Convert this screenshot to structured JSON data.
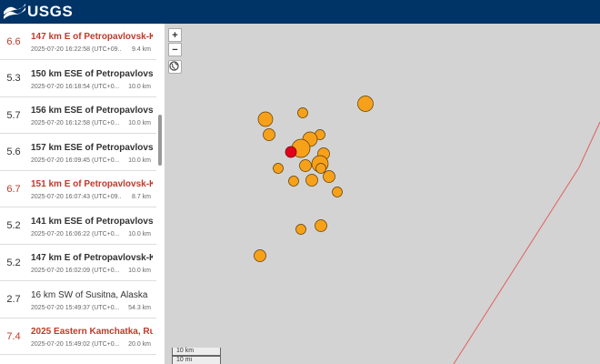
{
  "header": {
    "logo_text": "USGS"
  },
  "events": [
    {
      "mag": "6.6",
      "place": "147 km E of Petropavlovsk-K...",
      "time": "2025-07-20 16:22:58 (UTC+09...",
      "depth": "9.4 km",
      "significant": true,
      "lite": false
    },
    {
      "mag": "5.3",
      "place": "150 km ESE of Petropavlovsk...",
      "time": "2025-07-20 16:18:54 (UTC+0...",
      "depth": "10.0 km",
      "significant": false,
      "lite": false
    },
    {
      "mag": "5.7",
      "place": "156 km ESE of Petropavlovsk...",
      "time": "2025-07-20 16:12:58 (UTC+0...",
      "depth": "10.0 km",
      "significant": false,
      "lite": false
    },
    {
      "mag": "5.6",
      "place": "157 km ESE of Petropavlovsk...",
      "time": "2025-07-20 16:09:45 (UTC+0...",
      "depth": "10.0 km",
      "significant": false,
      "lite": false
    },
    {
      "mag": "6.7",
      "place": "151 km E of Petropavlovsk-K...",
      "time": "2025-07-20 16:07:43 (UTC+09...",
      "depth": "8.7 km",
      "significant": true,
      "lite": false
    },
    {
      "mag": "5.2",
      "place": "141 km ESE of Petropavlovsk...",
      "time": "2025-07-20 16:06:22 (UTC+0...",
      "depth": "10.0 km",
      "significant": false,
      "lite": false
    },
    {
      "mag": "5.2",
      "place": "147 km E of Petropavlovsk-K...",
      "time": "2025-07-20 16:02:09 (UTC+0...",
      "depth": "10.0 km",
      "significant": false,
      "lite": false
    },
    {
      "mag": "2.7",
      "place": "16 km SW of Susitna, Alaska",
      "time": "2025-07-20 15:49:37 (UTC+0...",
      "depth": "54.3 km",
      "significant": false,
      "lite": true
    },
    {
      "mag": "7.4",
      "place": "2025 Eastern Kamchatka, Rus...",
      "time": "2025-07-20 15:49:02 (UTC+0...",
      "depth": "20.0 km",
      "significant": true,
      "lite": false
    }
  ],
  "map": {
    "zoom_in": "+",
    "zoom_out": "−",
    "scale_km": "10 km",
    "scale_mi": "10 mi",
    "colors": {
      "background": "#d3d3d3",
      "quake_fill": "#f7a11a",
      "quake_stroke": "#5a3a00",
      "latest_fill": "#e3001b",
      "plate_line": "#e06060"
    }
  }
}
